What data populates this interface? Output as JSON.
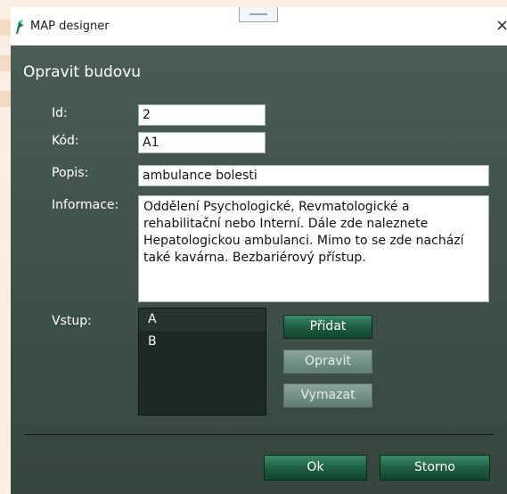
{
  "window": {
    "title": "MAP designer",
    "close_glyph": "×"
  },
  "dialog": {
    "heading": "Opravit budovu"
  },
  "form": {
    "id_label": "Id:",
    "id_value": "2",
    "kod_label": "Kód:",
    "kod_value": "A1",
    "popis_label": "Popis:",
    "popis_value": "ambulance bolesti",
    "informace_label": "Informace:",
    "informace_value": "Oddělení Psychologické, Revmatologické a rehabilitační nebo Interní. Dále zde naleznete Hepatologickou ambulanci. Mimo to se zde nachází také kavárna. Bezbariérový přístup.",
    "vstup_label": "Vstup:",
    "vstup_items": [
      "A",
      "B"
    ]
  },
  "buttons": {
    "pridat": "Přidat",
    "opravit": "Opravit",
    "vymazat": "Vymazat",
    "ok": "Ok",
    "storno": "Storno"
  },
  "icons": {
    "app": "map-designer-icon",
    "close": "close-icon",
    "grip": "window-grip-icon"
  }
}
